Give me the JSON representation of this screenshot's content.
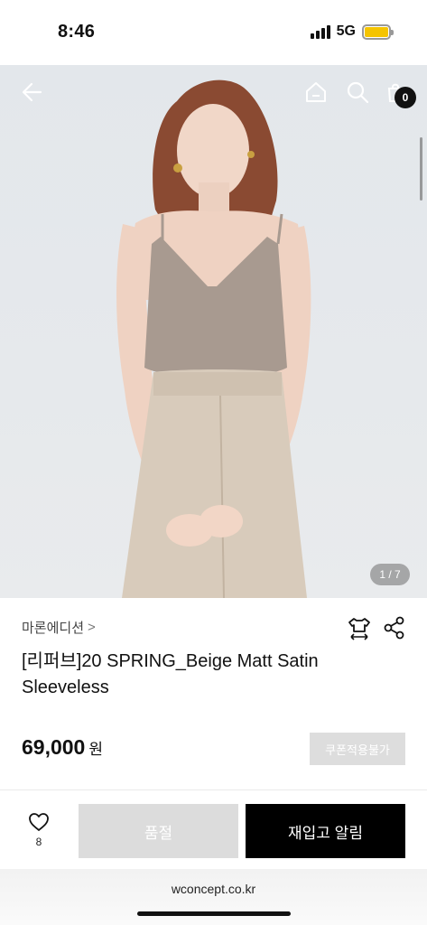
{
  "status_bar": {
    "time": "8:46",
    "network": "5G",
    "battery_color": "#f5c400",
    "signal_icon": "cellular-signal-icon",
    "battery_icon": "battery-icon"
  },
  "top_nav": {
    "back_icon": "arrow-left-icon",
    "home_icon": "home-icon",
    "search_icon": "search-icon",
    "cart_icon": "shopping-bag-icon",
    "cart_count": "0"
  },
  "hero": {
    "page_indicator": "1 / 7"
  },
  "product": {
    "brand": "마론에디션",
    "brand_chevron": ">",
    "title": "[리퍼브]20 SPRING_Beige Matt Satin Sleeveless",
    "price": "69,000",
    "price_unit": "원",
    "coupon_label": "쿠폰적용불가",
    "size_icon": "size-guide-icon",
    "share_icon": "share-icon"
  },
  "action_bar": {
    "like_icon": "heart-icon",
    "like_count": "8",
    "soldout_label": "품절",
    "restock_label": "재입고 알림"
  },
  "browser": {
    "url": "wconcept.co.kr"
  },
  "colors": {
    "accent_black": "#000000",
    "disabled_gray": "#dcdcdc",
    "background": "#ffffff"
  }
}
